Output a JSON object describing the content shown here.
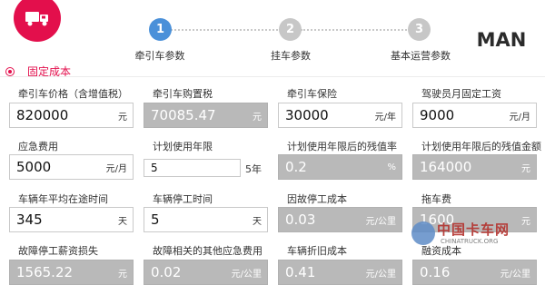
{
  "steps": [
    {
      "number": "1",
      "label": "牵引车参数",
      "active": true
    },
    {
      "number": "2",
      "label": "挂车参数",
      "active": false
    },
    {
      "number": "3",
      "label": "基本运营参数",
      "active": false
    }
  ],
  "brand": {
    "name": "MAN"
  },
  "section": {
    "title": "固定成本"
  },
  "fields": [
    {
      "label": "牵引车价格（含增值税）",
      "value": "820000",
      "unit": "元",
      "editable": true
    },
    {
      "label": "牵引车购置税",
      "value": "70085.47",
      "unit": "元",
      "editable": false
    },
    {
      "label": "牵引车保险",
      "value": "30000",
      "unit": "元/年",
      "editable": true
    },
    {
      "label": "驾驶员月固定工资",
      "value": "9000",
      "unit": "元/月",
      "editable": true
    },
    {
      "label": "应急费用",
      "value": "5000",
      "unit": "元/月",
      "editable": true
    },
    {
      "label": "计划使用年限",
      "value": "5",
      "unit": "5年",
      "editable": true,
      "select": true
    },
    {
      "label": "计划使用年限后的残值率",
      "value": "0.2",
      "unit": "%",
      "editable": false
    },
    {
      "label": "计划使用年限后的残值金额",
      "value": "164000",
      "unit": "元",
      "editable": false
    },
    {
      "label": "车辆年平均在途时间",
      "value": "345",
      "unit": "天",
      "editable": true
    },
    {
      "label": "车辆停工时间",
      "value": "5",
      "unit": "天",
      "editable": true
    },
    {
      "label": "因故停工成本",
      "value": "0.03",
      "unit": "元/公里",
      "editable": false
    },
    {
      "label": "拖车费",
      "value": "1600",
      "unit": "元",
      "editable": false
    },
    {
      "label": "故障停工薪资损失",
      "value": "1565.22",
      "unit": "元",
      "editable": false
    },
    {
      "label": "故障相关的其他应急费用",
      "value": "0.02",
      "unit": "元/公里",
      "editable": false
    },
    {
      "label": "车辆折旧成本",
      "value": "0.41",
      "unit": "元/公里",
      "editable": false
    },
    {
      "label": "融资成本",
      "value": "0.16",
      "unit": "元/公里",
      "editable": false
    }
  ],
  "watermark": {
    "title": "中国卡车网",
    "sub": "CHINATRUCK.ORG"
  },
  "colors": {
    "accent": "#e30f4c",
    "step_active": "#4a90d9",
    "step_inactive": "#c7c7c7",
    "readonly": "#b9b9b9"
  }
}
